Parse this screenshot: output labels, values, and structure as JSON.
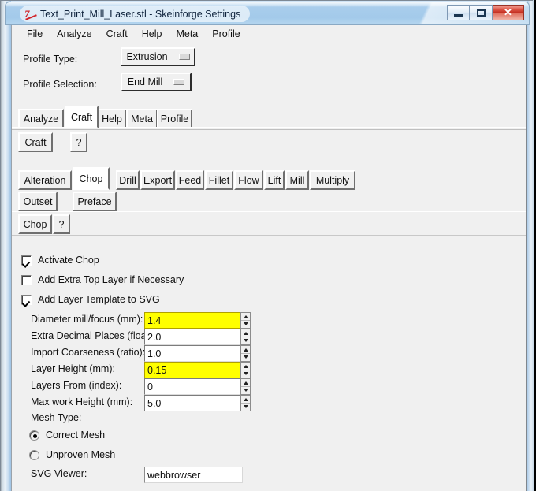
{
  "window": {
    "title": "Text_Print_Mill_Laser.stl - Skeinforge Settings",
    "icon": "tk-python-icon",
    "controls": {
      "minimize": "minimize-button",
      "maximize": "maximize-button",
      "close_label": "✕"
    }
  },
  "menubar": {
    "items": [
      {
        "label": "File"
      },
      {
        "label": "Analyze"
      },
      {
        "label": "Craft"
      },
      {
        "label": "Help"
      },
      {
        "label": "Meta"
      },
      {
        "label": "Profile"
      }
    ]
  },
  "profile": {
    "type_label": "Profile Type:",
    "type_value": "Extrusion",
    "selection_label": "Profile Selection:",
    "selection_value": "End Mill"
  },
  "main_tabs": {
    "items": [
      {
        "label": "Analyze",
        "selected": false
      },
      {
        "label": "Craft",
        "selected": true
      },
      {
        "label": "Help",
        "selected": false
      },
      {
        "label": "Meta",
        "selected": false
      },
      {
        "label": "Profile",
        "selected": false
      }
    ]
  },
  "craft_header": {
    "title_button": "Craft",
    "help_button": "?"
  },
  "craft_tabs": {
    "row1": [
      {
        "label": "Alteration",
        "selected": false
      },
      {
        "label": "Chop",
        "selected": true
      },
      {
        "label": "Drill",
        "selected": false
      },
      {
        "label": "Export",
        "selected": false
      },
      {
        "label": "Feed",
        "selected": false
      },
      {
        "label": "Fillet",
        "selected": false
      },
      {
        "label": "Flow",
        "selected": false
      },
      {
        "label": "Lift",
        "selected": false
      },
      {
        "label": "Mill",
        "selected": false
      },
      {
        "label": "Multiply",
        "selected": false
      }
    ],
    "row2": [
      {
        "label": "Outset",
        "selected": false
      },
      {
        "label": "Preface",
        "selected": false
      }
    ]
  },
  "chop_header": {
    "title_button": "Chop",
    "help_button": "?"
  },
  "settings": {
    "checkboxes": [
      {
        "label": "Activate Chop",
        "checked": true
      },
      {
        "label": "Add Extra Top Layer if Necessary",
        "checked": false
      },
      {
        "label": "Add Layer Template to SVG",
        "checked": true
      }
    ],
    "fields": [
      {
        "label": "Diameter mill/focus (mm):",
        "value": "1.4",
        "highlighted": true
      },
      {
        "label": "Extra Decimal Places (float):",
        "value": "2.0",
        "highlighted": false
      },
      {
        "label": "Import Coarseness (ratio):",
        "value": "1.0",
        "highlighted": false
      },
      {
        "label": "Layer Height (mm):",
        "value": "0.15",
        "highlighted": true
      },
      {
        "label": "Layers From (index):",
        "value": "0",
        "highlighted": false
      },
      {
        "label": "Max work Height (mm):",
        "value": "5.0",
        "highlighted": false
      }
    ],
    "mesh_type_label": "Mesh Type:",
    "mesh_options": [
      {
        "label": "Correct Mesh",
        "selected": true
      },
      {
        "label": "Unproven Mesh",
        "selected": false
      }
    ],
    "svg_viewer_label": "SVG Viewer:",
    "svg_viewer_value": "webbrowser"
  },
  "colors": {
    "highlight_field": "#ffff00",
    "title_accent": "#a9cdec",
    "close_button": "#c12a1d",
    "window_face": "#f0f0f0"
  }
}
